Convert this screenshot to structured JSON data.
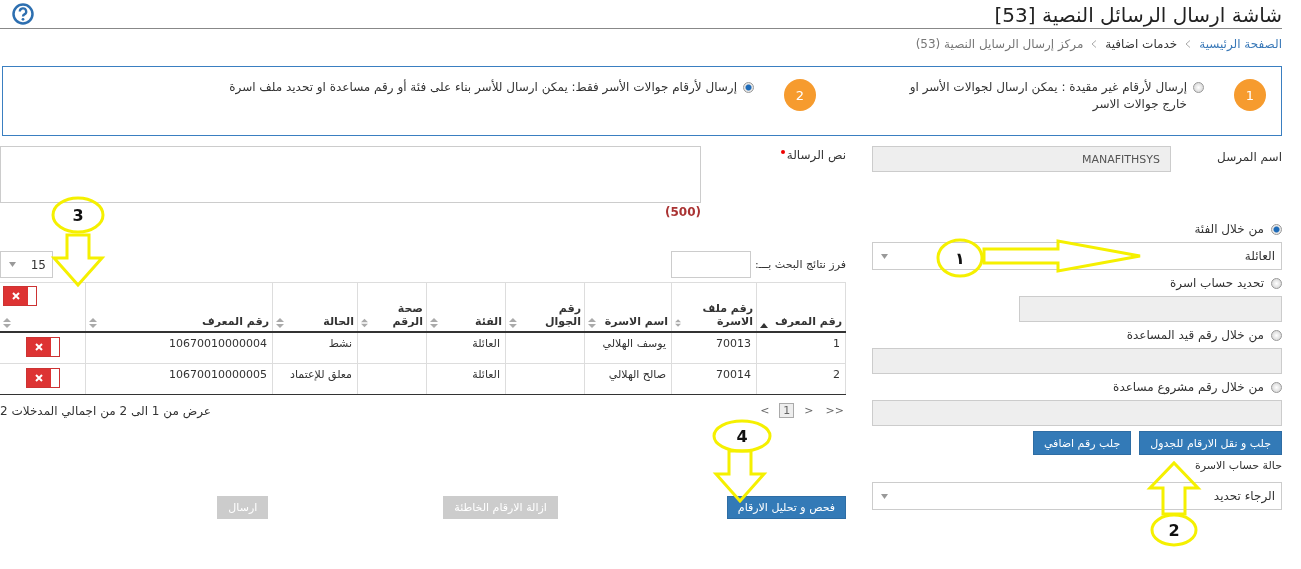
{
  "header": {
    "title": "شاشة ارسال الرسائل النصية [53]"
  },
  "breadcrumb": [
    {
      "label": "الصفحة الرئيسية",
      "kind": "link"
    },
    {
      "label": "خدمات اضافية",
      "kind": "section"
    },
    {
      "label": "مركز إرسال الرسايل النصية (53)",
      "kind": "current"
    }
  ],
  "send_modes": [
    {
      "number": "1",
      "label": "إرسال لأرقام غير مقيدة : يمكن ارسال لجوالات الأسر او خارج جوالات الاسر",
      "selected": false
    },
    {
      "number": "2",
      "label": "إرسال لأرقام جوالات الأسر فقط: يمكن ارسال للأسر بناء على فئة أو رقم مساعدة او تحديد ملف اسرة",
      "selected": true
    }
  ],
  "sender": {
    "label": "اسم المرسل",
    "value": "MANAFITHSYS"
  },
  "message": {
    "label": "نص الرسالة",
    "required": true,
    "counter": "(500)"
  },
  "sources": [
    {
      "label": "من خلال الفئة",
      "selected": true,
      "kind": "select",
      "value": "العائلة"
    },
    {
      "label": "تحديد حساب اسرة",
      "selected": false,
      "kind": "short_input"
    },
    {
      "label": "من خلال رقم قيد المساعدة",
      "selected": false,
      "kind": "input"
    },
    {
      "label": "من خلال رقم مشروع مساعدة",
      "selected": false,
      "kind": "input"
    }
  ],
  "source_buttons": [
    "جلب و نقل الارقام للجدول",
    "جلب رقم اضافي"
  ],
  "family_status": {
    "label": "حالة حساب الاسرة",
    "value": "الرجاء تحديد"
  },
  "results": {
    "sort_label": "فرز نتائج البحث بـــ:",
    "page_size": "15"
  },
  "table": {
    "columns": [
      {
        "label": "رقم المعرف",
        "sorted": true
      },
      {
        "label": "رقم ملف الاسرة",
        "sorted": false
      },
      {
        "label": "اسم الاسرة",
        "sorted": false
      },
      {
        "label": "رقم الجوال",
        "sorted": false
      },
      {
        "label": "الفئة",
        "sorted": false
      },
      {
        "label": "صحة الرقم",
        "sorted": false
      },
      {
        "label": "الحالة",
        "sorted": false
      },
      {
        "label": "رقم المعرف",
        "sorted": false
      }
    ],
    "rows": [
      {
        "cells": [
          "1",
          "70013",
          "يوسف الهلالي",
          null,
          "العائلة",
          null,
          "نشط",
          "10670010000004"
        ]
      },
      {
        "cells": [
          "2",
          "70014",
          "صالح الهلالي",
          null,
          "العائلة",
          null,
          "معلق للإعتماد",
          "10670010000005"
        ]
      }
    ]
  },
  "pagination": {
    "buttons": [
      {
        "label": ">>",
        "selected": false
      },
      {
        "label": ">",
        "selected": false
      },
      {
        "label": "1",
        "selected": true
      },
      {
        "label": "<",
        "selected": false
      }
    ],
    "summary": "عرض من 1 الى 2 من اجمالي المدخلات 2"
  },
  "actions": [
    {
      "label": "فحص و تحليل الارقام",
      "disabled": false
    },
    {
      "label": "ازالة الارقام الخاطئة",
      "disabled": true
    },
    {
      "label": "ارسال",
      "disabled": true
    }
  ],
  "annotations": [
    {
      "number": "3",
      "kind": "down"
    },
    {
      "number": "١",
      "kind": "right"
    },
    {
      "number": "2",
      "kind": "up"
    },
    {
      "number": "4",
      "kind": "down"
    }
  ]
}
